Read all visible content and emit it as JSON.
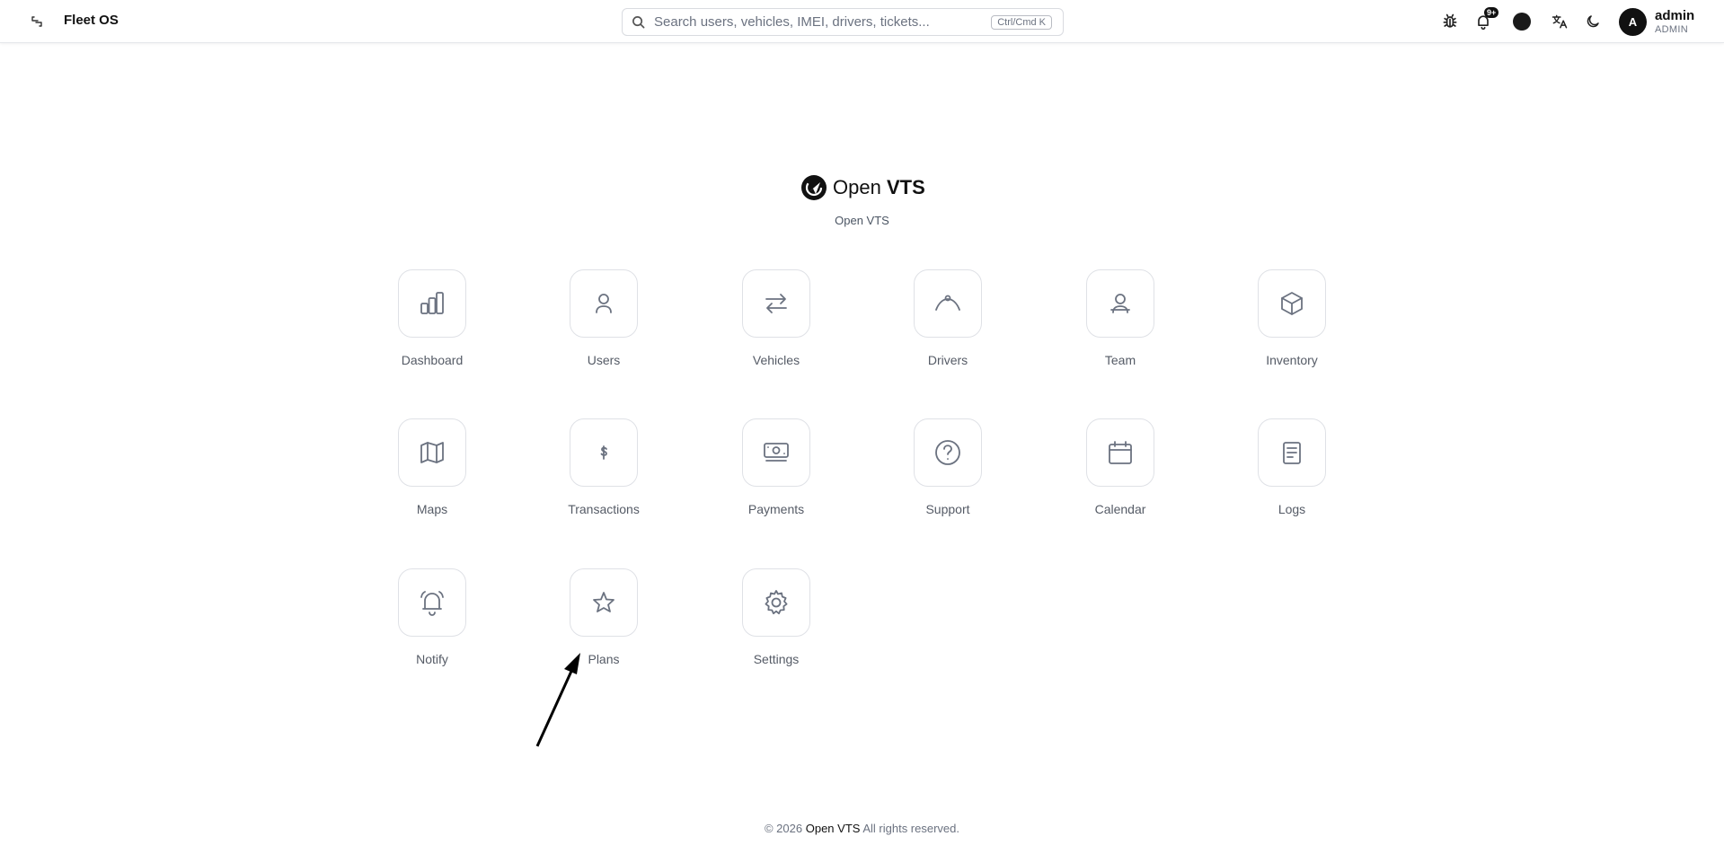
{
  "header": {
    "title": "Fleet OS",
    "search_placeholder": "Search users, vehicles, IMEI, drivers, tickets...",
    "search_shortcut": "Ctrl/Cmd K",
    "notification_badge": "9+",
    "user": {
      "avatar_initial": "A",
      "name": "admin",
      "role": "ADMIN"
    }
  },
  "branding": {
    "logo_word_1": "Open",
    "logo_word_2": "VTS",
    "subtitle": "Open VTS"
  },
  "apps": [
    {
      "label": "Dashboard",
      "icon": "bar-chart-icon"
    },
    {
      "label": "Users",
      "icon": "user-icon"
    },
    {
      "label": "Vehicles",
      "icon": "arrows-exchange-icon"
    },
    {
      "label": "Drivers",
      "icon": "steering-icon"
    },
    {
      "label": "Team",
      "icon": "team-icon"
    },
    {
      "label": "Inventory",
      "icon": "box-icon"
    },
    {
      "label": "Maps",
      "icon": "map-icon"
    },
    {
      "label": "Transactions",
      "icon": "currency-icon"
    },
    {
      "label": "Payments",
      "icon": "banknote-icon"
    },
    {
      "label": "Support",
      "icon": "help-circle-icon"
    },
    {
      "label": "Calendar",
      "icon": "calendar-icon"
    },
    {
      "label": "Logs",
      "icon": "document-icon"
    },
    {
      "label": "Notify",
      "icon": "bell-ring-icon"
    },
    {
      "label": "Plans",
      "icon": "star-icon"
    },
    {
      "label": "Settings",
      "icon": "gear-icon"
    }
  ],
  "footer": {
    "prefix": "© 2026",
    "brand": "Open VTS",
    "suffix": "All rights reserved."
  },
  "colors": {
    "accent": "#111111",
    "icon_gray": "#6b7280",
    "border": "#dfe1e6"
  }
}
